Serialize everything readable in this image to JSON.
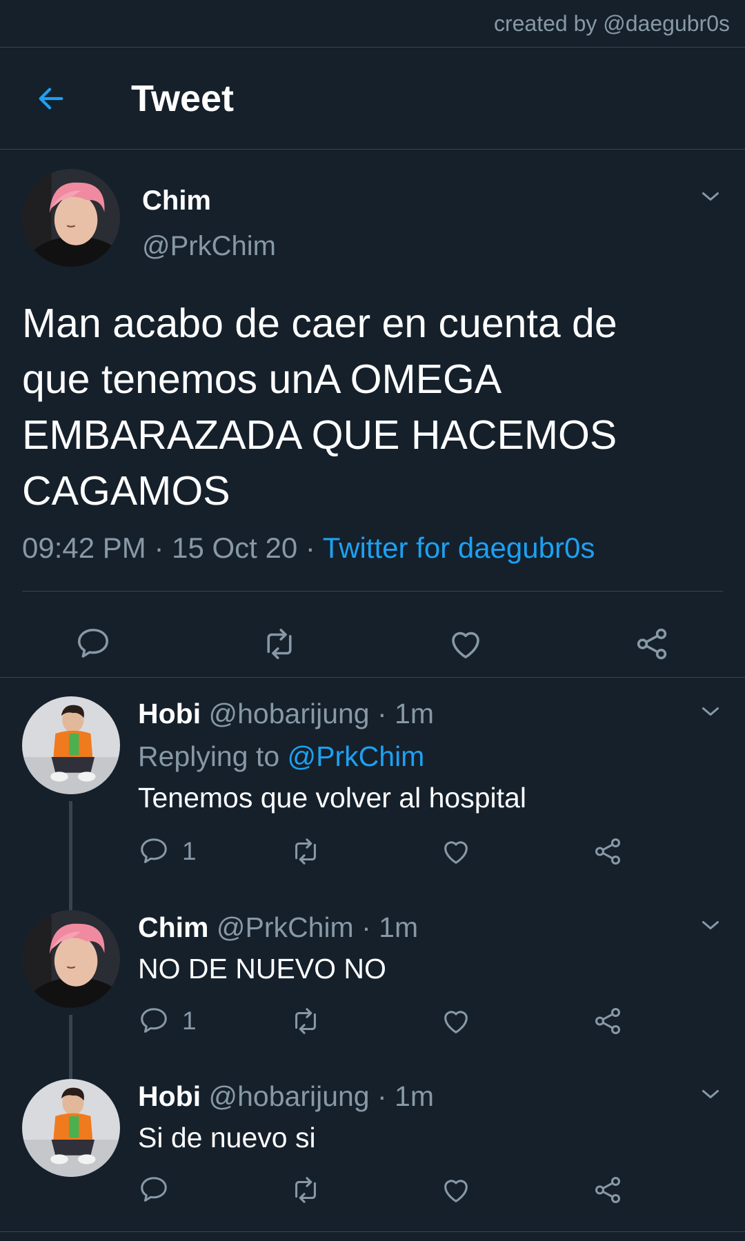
{
  "credit": "created by @daegubr0s",
  "header": {
    "title": "Tweet"
  },
  "main_tweet": {
    "name": "Chim",
    "handle": "@PrkChim",
    "text": "Man acabo de caer en cuenta de que tenemos unA OMEGA EMBARAZADA QUE HACEMOS CAGAMOS",
    "time": "09:42 PM",
    "date": "15 Oct 20",
    "source": "Twitter for daegubr0s",
    "separator": " · "
  },
  "replies": [
    {
      "name": "Hobi",
      "handle": "@hobarijung",
      "time": "1m",
      "replying_to_label": "Replying to",
      "replying_to": "@PrkChim",
      "text": "Tenemos que volver al hospital",
      "reply_count": "1"
    },
    {
      "name": "Chim",
      "handle": "@PrkChim",
      "time": "1m",
      "text": "NO DE NUEVO NO",
      "reply_count": "1"
    },
    {
      "name": "Hobi",
      "handle": "@hobarijung",
      "time": "1m",
      "text": "Si de nuevo si",
      "reply_count": ""
    }
  ],
  "icons": {
    "back": "arrow-left-icon",
    "more": "chevron-down-icon",
    "reply": "comment-icon",
    "retweet": "retweet-icon",
    "like": "heart-icon",
    "share": "share-icon"
  },
  "colors": {
    "background": "#15202b",
    "border": "#38444d",
    "muted": "#8899a6",
    "accent": "#1da1f2",
    "text": "#ffffff"
  }
}
